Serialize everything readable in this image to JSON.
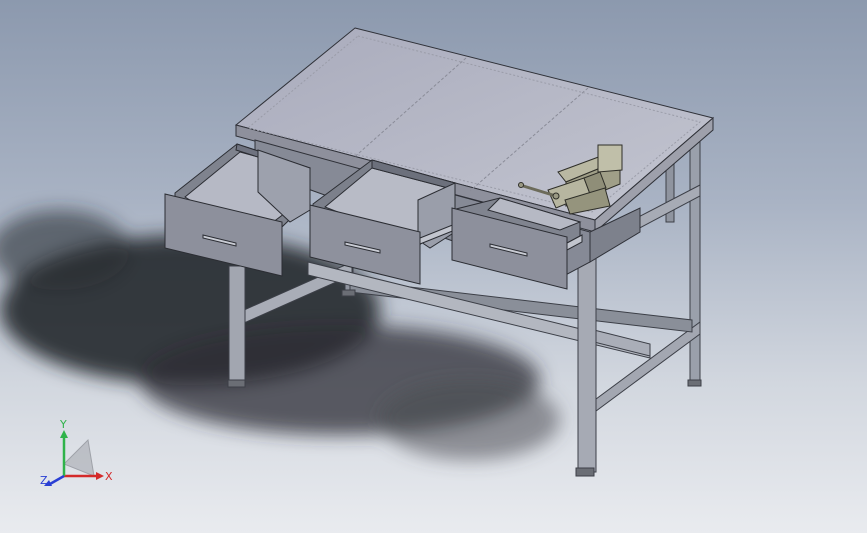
{
  "triad": {
    "x_label": "X",
    "y_label": "Y",
    "z_label": "Z",
    "x_color": "#d42a2a",
    "y_color": "#2fb34a",
    "z_color": "#2a3fd4"
  },
  "model": {
    "drawer_count": 3,
    "drawer_color": "#8d909c",
    "frame_color": "#9ea3ae",
    "top_color": "#b4b6c4",
    "vise_color": "#a8a78f"
  }
}
